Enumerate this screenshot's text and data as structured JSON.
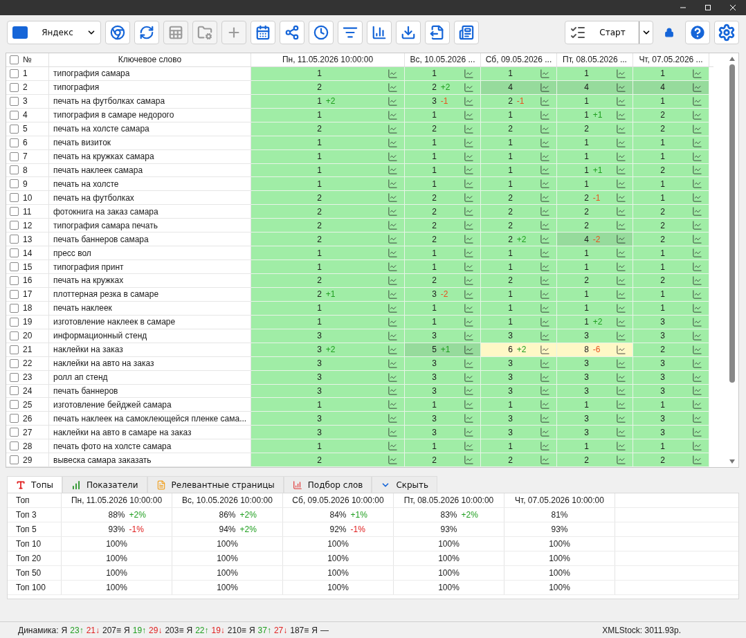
{
  "toolbar": {
    "engine": "Яндекс",
    "buttons": [
      {
        "disabled": false
      },
      {
        "disabled": false
      },
      {
        "disabled": true
      },
      {
        "disabled": true
      },
      {
        "disabled": true
      },
      {
        "disabled": false
      },
      {
        "disabled": false
      },
      {
        "disabled": false
      },
      {
        "disabled": false
      },
      {
        "disabled": false
      },
      {
        "disabled": false
      },
      {
        "disabled": false
      },
      {
        "disabled": false
      }
    ],
    "start": "Старт"
  },
  "table": {
    "number_header": "№",
    "keyword_header": "Ключевое слово",
    "columns": [
      "Пн, 11.05.2026 10:00:00",
      "Вс, 10.05.2026 ...",
      "Сб, 09.05.2026 ...",
      "Пт, 08.05.2026 ...",
      "Чт, 07.05.2026 ..."
    ],
    "all_checked": false,
    "rows": [
      {
        "n": "1",
        "keyword": "типография самара",
        "checked": false,
        "cells": [
          {
            "value": "1",
            "color": "#a0eda6"
          },
          {
            "value": "1",
            "color": "#a0eda6"
          },
          {
            "value": "1",
            "color": "#a0eda6"
          },
          {
            "value": "1",
            "color": "#a0eda6"
          },
          {
            "value": "1",
            "color": "#a0eda6"
          }
        ]
      },
      {
        "n": "2",
        "keyword": "типография",
        "checked": false,
        "cells": [
          {
            "value": "2",
            "color": "#a0eda6"
          },
          {
            "value": "2",
            "change": {
              "text": "+2",
              "color": "#1e9e1e"
            },
            "color": "#a0eda6"
          },
          {
            "value": "4",
            "color": "#96db9c"
          },
          {
            "value": "4",
            "color": "#96db9c"
          },
          {
            "value": "4",
            "color": "#96db9c"
          }
        ]
      },
      {
        "n": "3",
        "keyword": "печать на футболках самара",
        "checked": false,
        "cells": [
          {
            "value": "1",
            "change": {
              "text": "+2",
              "color": "#1e9e1e"
            },
            "color": "#a0eda6"
          },
          {
            "value": "3",
            "change": {
              "text": "-1",
              "color": "#e8501e"
            },
            "color": "#a0eda6"
          },
          {
            "value": "2",
            "change": {
              "text": "-1",
              "color": "#e8501e"
            },
            "color": "#a0eda6"
          },
          {
            "value": "1",
            "color": "#a0eda6"
          },
          {
            "value": "1",
            "color": "#a0eda6"
          }
        ]
      },
      {
        "n": "4",
        "keyword": "типография в самаре недорого",
        "checked": false,
        "cells": [
          {
            "value": "1",
            "color": "#a0eda6"
          },
          {
            "value": "1",
            "color": "#a0eda6"
          },
          {
            "value": "1",
            "color": "#a0eda6"
          },
          {
            "value": "1",
            "change": {
              "text": "+1",
              "color": "#1e9e1e"
            },
            "color": "#a0eda6"
          },
          {
            "value": "2",
            "color": "#a0eda6"
          }
        ]
      },
      {
        "n": "5",
        "keyword": "печать на холсте самара",
        "checked": false,
        "cells": [
          {
            "value": "2",
            "color": "#a0eda6"
          },
          {
            "value": "2",
            "color": "#a0eda6"
          },
          {
            "value": "2",
            "color": "#a0eda6"
          },
          {
            "value": "2",
            "color": "#a0eda6"
          },
          {
            "value": "2",
            "color": "#a0eda6"
          }
        ]
      },
      {
        "n": "6",
        "keyword": "печать визиток",
        "checked": false,
        "cells": [
          {
            "value": "1",
            "color": "#a0eda6"
          },
          {
            "value": "1",
            "color": "#a0eda6"
          },
          {
            "value": "1",
            "color": "#a0eda6"
          },
          {
            "value": "1",
            "color": "#a0eda6"
          },
          {
            "value": "1",
            "color": "#a0eda6"
          }
        ]
      },
      {
        "n": "7",
        "keyword": "печать на кружках самара",
        "checked": false,
        "cells": [
          {
            "value": "1",
            "color": "#a0eda6"
          },
          {
            "value": "1",
            "color": "#a0eda6"
          },
          {
            "value": "1",
            "color": "#a0eda6"
          },
          {
            "value": "1",
            "color": "#a0eda6"
          },
          {
            "value": "1",
            "color": "#a0eda6"
          }
        ]
      },
      {
        "n": "8",
        "keyword": "печать наклеек самара",
        "checked": false,
        "cells": [
          {
            "value": "1",
            "color": "#a0eda6"
          },
          {
            "value": "1",
            "color": "#a0eda6"
          },
          {
            "value": "1",
            "color": "#a0eda6"
          },
          {
            "value": "1",
            "change": {
              "text": "+1",
              "color": "#1e9e1e"
            },
            "color": "#a0eda6"
          },
          {
            "value": "2",
            "color": "#a0eda6"
          }
        ]
      },
      {
        "n": "9",
        "keyword": "печать на холсте",
        "checked": false,
        "cells": [
          {
            "value": "1",
            "color": "#a0eda6"
          },
          {
            "value": "1",
            "color": "#a0eda6"
          },
          {
            "value": "1",
            "color": "#a0eda6"
          },
          {
            "value": "1",
            "color": "#a0eda6"
          },
          {
            "value": "1",
            "color": "#a0eda6"
          }
        ]
      },
      {
        "n": "10",
        "keyword": "печать на футболках",
        "checked": false,
        "cells": [
          {
            "value": "2",
            "color": "#a0eda6"
          },
          {
            "value": "2",
            "color": "#a0eda6"
          },
          {
            "value": "2",
            "color": "#a0eda6"
          },
          {
            "value": "2",
            "change": {
              "text": "-1",
              "color": "#e8501e"
            },
            "color": "#a0eda6"
          },
          {
            "value": "1",
            "color": "#a0eda6"
          }
        ]
      },
      {
        "n": "11",
        "keyword": "фотокнига на заказ самара",
        "checked": false,
        "cells": [
          {
            "value": "2",
            "color": "#a0eda6"
          },
          {
            "value": "2",
            "color": "#a0eda6"
          },
          {
            "value": "2",
            "color": "#a0eda6"
          },
          {
            "value": "2",
            "color": "#a0eda6"
          },
          {
            "value": "2",
            "color": "#a0eda6"
          }
        ]
      },
      {
        "n": "12",
        "keyword": "типография самара печать",
        "checked": false,
        "cells": [
          {
            "value": "2",
            "color": "#a0eda6"
          },
          {
            "value": "2",
            "color": "#a0eda6"
          },
          {
            "value": "2",
            "color": "#a0eda6"
          },
          {
            "value": "2",
            "color": "#a0eda6"
          },
          {
            "value": "2",
            "color": "#a0eda6"
          }
        ]
      },
      {
        "n": "13",
        "keyword": "печать баннеров самара",
        "checked": false,
        "cells": [
          {
            "value": "2",
            "color": "#a0eda6"
          },
          {
            "value": "2",
            "color": "#a0eda6"
          },
          {
            "value": "2",
            "change": {
              "text": "+2",
              "color": "#1e9e1e"
            },
            "color": "#a0eda6"
          },
          {
            "value": "4",
            "change": {
              "text": "-2",
              "color": "#e8501e"
            },
            "color": "#96db9c"
          },
          {
            "value": "2",
            "color": "#a0eda6"
          }
        ]
      },
      {
        "n": "14",
        "keyword": "пресс вол",
        "checked": false,
        "cells": [
          {
            "value": "1",
            "color": "#a0eda6"
          },
          {
            "value": "1",
            "color": "#a0eda6"
          },
          {
            "value": "1",
            "color": "#a0eda6"
          },
          {
            "value": "1",
            "color": "#a0eda6"
          },
          {
            "value": "1",
            "color": "#a0eda6"
          }
        ]
      },
      {
        "n": "15",
        "keyword": "типография принт",
        "checked": false,
        "cells": [
          {
            "value": "1",
            "color": "#a0eda6"
          },
          {
            "value": "1",
            "color": "#a0eda6"
          },
          {
            "value": "1",
            "color": "#a0eda6"
          },
          {
            "value": "1",
            "color": "#a0eda6"
          },
          {
            "value": "1",
            "color": "#a0eda6"
          }
        ]
      },
      {
        "n": "16",
        "keyword": "печать на кружках",
        "checked": false,
        "cells": [
          {
            "value": "2",
            "color": "#a0eda6"
          },
          {
            "value": "2",
            "color": "#a0eda6"
          },
          {
            "value": "2",
            "color": "#a0eda6"
          },
          {
            "value": "2",
            "color": "#a0eda6"
          },
          {
            "value": "2",
            "color": "#a0eda6"
          }
        ]
      },
      {
        "n": "17",
        "keyword": "плоттерная резка в самаре",
        "checked": false,
        "cells": [
          {
            "value": "2",
            "change": {
              "text": "+1",
              "color": "#1e9e1e"
            },
            "color": "#a0eda6"
          },
          {
            "value": "3",
            "change": {
              "text": "-2",
              "color": "#e8501e"
            },
            "color": "#a0eda6"
          },
          {
            "value": "1",
            "color": "#a0eda6"
          },
          {
            "value": "1",
            "color": "#a0eda6"
          },
          {
            "value": "1",
            "color": "#a0eda6"
          }
        ]
      },
      {
        "n": "18",
        "keyword": "печать наклеек",
        "checked": false,
        "cells": [
          {
            "value": "1",
            "color": "#a0eda6"
          },
          {
            "value": "1",
            "color": "#a0eda6"
          },
          {
            "value": "1",
            "color": "#a0eda6"
          },
          {
            "value": "1",
            "color": "#a0eda6"
          },
          {
            "value": "1",
            "color": "#a0eda6"
          }
        ]
      },
      {
        "n": "19",
        "keyword": "изготовление наклеек в самаре",
        "checked": false,
        "cells": [
          {
            "value": "1",
            "color": "#a0eda6"
          },
          {
            "value": "1",
            "color": "#a0eda6"
          },
          {
            "value": "1",
            "color": "#a0eda6"
          },
          {
            "value": "1",
            "change": {
              "text": "+2",
              "color": "#1e9e1e"
            },
            "color": "#a0eda6"
          },
          {
            "value": "3",
            "color": "#a0eda6"
          }
        ]
      },
      {
        "n": "20",
        "keyword": "информационный стенд",
        "checked": false,
        "cells": [
          {
            "value": "3",
            "color": "#a0eda6"
          },
          {
            "value": "3",
            "color": "#a0eda6"
          },
          {
            "value": "3",
            "color": "#a0eda6"
          },
          {
            "value": "3",
            "color": "#a0eda6"
          },
          {
            "value": "3",
            "color": "#a0eda6"
          }
        ]
      },
      {
        "n": "21",
        "keyword": "наклейки на заказ",
        "checked": false,
        "cells": [
          {
            "value": "3",
            "change": {
              "text": "+2",
              "color": "#1e9e1e"
            },
            "color": "#a0eda6"
          },
          {
            "value": "5",
            "change": {
              "text": "+1",
              "color": "#1e9e1e"
            },
            "color": "#96db9c"
          },
          {
            "value": "6",
            "change": {
              "text": "+2",
              "color": "#1e9e1e"
            },
            "color": "#fff8c6"
          },
          {
            "value": "8",
            "change": {
              "text": "-6",
              "color": "#e8501e"
            },
            "color": "#fff8c6"
          },
          {
            "value": "2",
            "color": "#a0eda6"
          }
        ]
      },
      {
        "n": "22",
        "keyword": "наклейки на авто на заказ",
        "checked": false,
        "cells": [
          {
            "value": "3",
            "color": "#a0eda6"
          },
          {
            "value": "3",
            "color": "#a0eda6"
          },
          {
            "value": "3",
            "color": "#a0eda6"
          },
          {
            "value": "3",
            "color": "#a0eda6"
          },
          {
            "value": "3",
            "color": "#a0eda6"
          }
        ]
      },
      {
        "n": "23",
        "keyword": "ролл ап стенд",
        "checked": false,
        "cells": [
          {
            "value": "3",
            "color": "#a0eda6"
          },
          {
            "value": "3",
            "color": "#a0eda6"
          },
          {
            "value": "3",
            "color": "#a0eda6"
          },
          {
            "value": "3",
            "color": "#a0eda6"
          },
          {
            "value": "3",
            "color": "#a0eda6"
          }
        ]
      },
      {
        "n": "24",
        "keyword": "печать баннеров",
        "checked": false,
        "cells": [
          {
            "value": "3",
            "color": "#a0eda6"
          },
          {
            "value": "3",
            "color": "#a0eda6"
          },
          {
            "value": "3",
            "color": "#a0eda6"
          },
          {
            "value": "3",
            "color": "#a0eda6"
          },
          {
            "value": "3",
            "color": "#a0eda6"
          }
        ]
      },
      {
        "n": "25",
        "keyword": "изготовление бейджей самара",
        "checked": false,
        "cells": [
          {
            "value": "1",
            "color": "#a0eda6"
          },
          {
            "value": "1",
            "color": "#a0eda6"
          },
          {
            "value": "1",
            "color": "#a0eda6"
          },
          {
            "value": "1",
            "color": "#a0eda6"
          },
          {
            "value": "1",
            "color": "#a0eda6"
          }
        ]
      },
      {
        "n": "26",
        "keyword": "печать наклеек на самоклеющейся пленке сама...",
        "checked": false,
        "cells": [
          {
            "value": "3",
            "color": "#a0eda6"
          },
          {
            "value": "3",
            "color": "#a0eda6"
          },
          {
            "value": "3",
            "color": "#a0eda6"
          },
          {
            "value": "3",
            "color": "#a0eda6"
          },
          {
            "value": "3",
            "color": "#a0eda6"
          }
        ]
      },
      {
        "n": "27",
        "keyword": "наклейки на авто в самаре на заказ",
        "checked": false,
        "cells": [
          {
            "value": "3",
            "color": "#a0eda6"
          },
          {
            "value": "3",
            "color": "#a0eda6"
          },
          {
            "value": "3",
            "color": "#a0eda6"
          },
          {
            "value": "3",
            "color": "#a0eda6"
          },
          {
            "value": "3",
            "color": "#a0eda6"
          }
        ]
      },
      {
        "n": "28",
        "keyword": "печать фото на холсте самара",
        "checked": false,
        "cells": [
          {
            "value": "1",
            "color": "#a0eda6"
          },
          {
            "value": "1",
            "color": "#a0eda6"
          },
          {
            "value": "1",
            "color": "#a0eda6"
          },
          {
            "value": "1",
            "color": "#a0eda6"
          },
          {
            "value": "1",
            "color": "#a0eda6"
          }
        ]
      },
      {
        "n": "29",
        "keyword": "вывеска самара заказать",
        "checked": false,
        "cells": [
          {
            "value": "2",
            "color": "#a0eda6"
          },
          {
            "value": "2",
            "color": "#a0eda6"
          },
          {
            "value": "2",
            "color": "#a0eda6"
          },
          {
            "value": "2",
            "color": "#a0eda6"
          },
          {
            "value": "2",
            "color": "#a0eda6"
          }
        ]
      }
    ]
  },
  "bottom_tabs": [
    {
      "label": "Топы",
      "selected": true
    },
    {
      "label": "Показатели",
      "selected": false
    },
    {
      "label": "Релевантные страницы",
      "selected": false
    },
    {
      "label": "Подбор слов",
      "selected": false
    },
    {
      "label": "Скрыть",
      "selected": false
    }
  ],
  "tops": {
    "corner": "Топ",
    "columns": [
      "Пн, 11.05.2026 10:00:00",
      "Вс, 10.05.2026 10:00:00",
      "Сб, 09.05.2026 10:00:00",
      "Пт, 08.05.2026 10:00:00",
      "Чт, 07.05.2026 10:00:00"
    ],
    "rows": [
      {
        "label": "Топ 3",
        "cells": [
          {
            "value": "88%",
            "change": {
              "text": "+2%",
              "color": "#1e9e1e"
            }
          },
          {
            "value": "86%",
            "change": {
              "text": "+2%",
              "color": "#1e9e1e"
            }
          },
          {
            "value": "84%",
            "change": {
              "text": "+1%",
              "color": "#1e9e1e"
            }
          },
          {
            "value": "83%",
            "change": {
              "text": "+2%",
              "color": "#1e9e1e"
            }
          },
          {
            "value": "81%"
          }
        ]
      },
      {
        "label": "Топ 5",
        "cells": [
          {
            "value": "93%",
            "change": {
              "text": "-1%",
              "color": "#e02020"
            }
          },
          {
            "value": "94%",
            "change": {
              "text": "+2%",
              "color": "#1e9e1e"
            }
          },
          {
            "value": "92%",
            "change": {
              "text": "-1%",
              "color": "#e02020"
            }
          },
          {
            "value": "93%"
          },
          {
            "value": "93%"
          }
        ]
      },
      {
        "label": "Топ 10",
        "cells": [
          {
            "value": "100%"
          },
          {
            "value": "100%"
          },
          {
            "value": "100%"
          },
          {
            "value": "100%"
          },
          {
            "value": "100%"
          }
        ]
      },
      {
        "label": "Топ 20",
        "cells": [
          {
            "value": "100%"
          },
          {
            "value": "100%"
          },
          {
            "value": "100%"
          },
          {
            "value": "100%"
          },
          {
            "value": "100%"
          }
        ]
      },
      {
        "label": "Топ 50",
        "cells": [
          {
            "value": "100%"
          },
          {
            "value": "100%"
          },
          {
            "value": "100%"
          },
          {
            "value": "100%"
          },
          {
            "value": "100%"
          }
        ]
      },
      {
        "label": "Топ 100",
        "cells": [
          {
            "value": "100%"
          },
          {
            "value": "100%"
          },
          {
            "value": "100%"
          },
          {
            "value": "100%"
          },
          {
            "value": "100%"
          }
        ]
      }
    ]
  },
  "status_bar": {
    "dynamics": [
      {
        "text": "Динамика:"
      },
      {
        "text": "Я"
      },
      {
        "text": "23↑",
        "color": "#1e9e1e"
      },
      {
        "text": "21↓",
        "color": "#e02020"
      },
      {
        "text": "207≡"
      },
      {
        "text": "Я"
      },
      {
        "text": "19↑",
        "color": "#1e9e1e"
      },
      {
        "text": "29↓",
        "color": "#e02020"
      },
      {
        "text": "203≡"
      },
      {
        "text": "Я"
      },
      {
        "text": "22↑",
        "color": "#1e9e1e"
      },
      {
        "text": "19↓",
        "color": "#e02020"
      },
      {
        "text": "210≡"
      },
      {
        "text": "Я"
      },
      {
        "text": "37↑",
        "color": "#1e9e1e"
      },
      {
        "text": "27↓",
        "color": "#e02020"
      },
      {
        "text": "187≡"
      },
      {
        "text": "Я"
      },
      {
        "text": "—"
      }
    ],
    "balance": "XMLStock: 3011.93р."
  }
}
